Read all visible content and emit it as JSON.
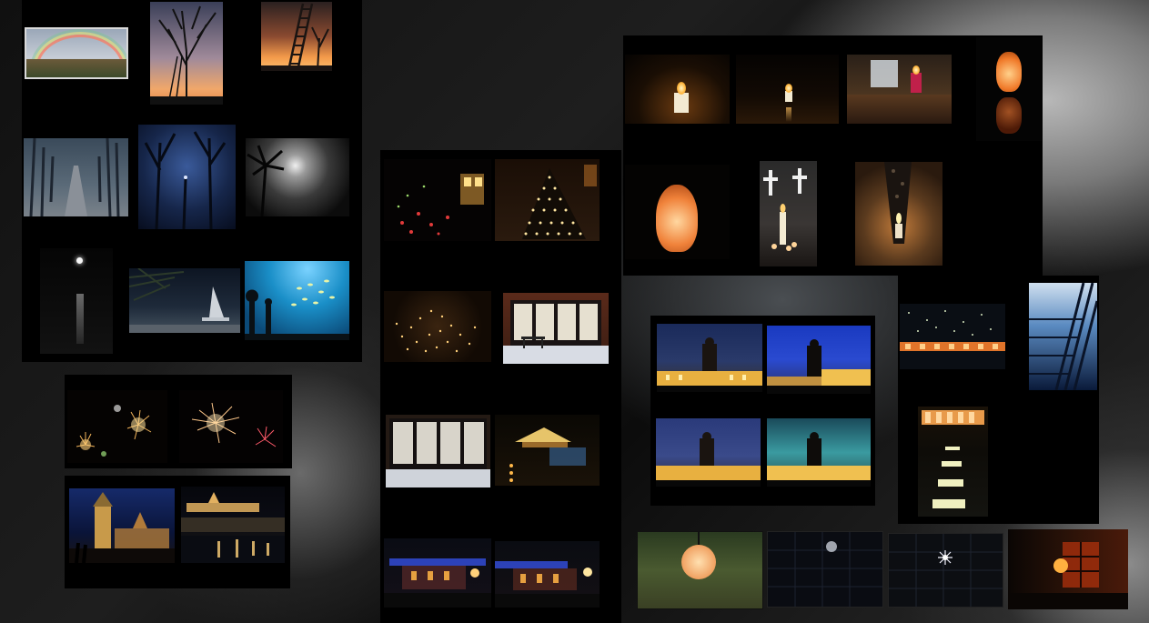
{
  "collage": {
    "groups": [
      {
        "name": "nature-and-night"
      },
      {
        "name": "fireworks"
      },
      {
        "name": "city-at-night"
      },
      {
        "name": "christmas-lights"
      },
      {
        "name": "candles-and-lamps"
      },
      {
        "name": "monument-at-dusk"
      },
      {
        "name": "architecture-lights"
      },
      {
        "name": "lanterns-and-windows"
      }
    ]
  }
}
